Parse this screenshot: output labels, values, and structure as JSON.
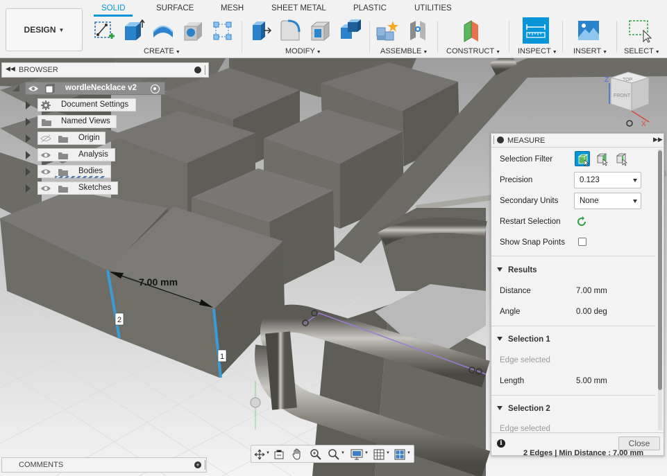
{
  "toolbar": {
    "workspace_label": "DESIGN",
    "tabs": [
      "SOLID",
      "SURFACE",
      "MESH",
      "SHEET METAL",
      "PLASTIC",
      "UTILITIES"
    ],
    "groups": [
      "CREATE",
      "MODIFY",
      "ASSEMBLE",
      "CONSTRUCT",
      "INSPECT",
      "INSERT",
      "SELECT"
    ]
  },
  "browser": {
    "title": "BROWSER",
    "root": "wordleNecklace v2",
    "items": [
      "Document Settings",
      "Named Views",
      "Origin",
      "Analysis",
      "Bodies",
      "Sketches"
    ]
  },
  "canvas": {
    "dimension": "7.00 mm",
    "edge_label_1": "1",
    "edge_label_2": "2",
    "viewcube_top": "TOP",
    "viewcube_front": "FRONT",
    "axis_z": "Z",
    "axis_x": "X"
  },
  "measure": {
    "title": "MEASURE",
    "selection_filter_label": "Selection Filter",
    "precision_label": "Precision",
    "precision_value": "0.123",
    "secondary_units_label": "Secondary Units",
    "secondary_units_value": "None",
    "restart_selection_label": "Restart Selection",
    "show_snap_points_label": "Show Snap Points",
    "results": {
      "title": "Results",
      "distance_label": "Distance",
      "distance_value": "7.00 mm",
      "angle_label": "Angle",
      "angle_value": "0.00 deg"
    },
    "selection1": {
      "title": "Selection 1",
      "status": "Edge selected",
      "length_label": "Length",
      "length_value": "5.00 mm"
    },
    "selection2": {
      "title": "Selection 2",
      "status": "Edge selected"
    },
    "close_label": "Close",
    "footer": "2 Edges | Min Distance : 7.00 mm"
  },
  "comments": {
    "title": "COMMENTS"
  },
  "colors": {
    "accent": "#0696d7",
    "toolbar_bg": "#f2f2f2",
    "panel_bg": "#f3f3f3",
    "body_gray": "#6f6e69",
    "selected_edge": "#3a9bd8"
  }
}
